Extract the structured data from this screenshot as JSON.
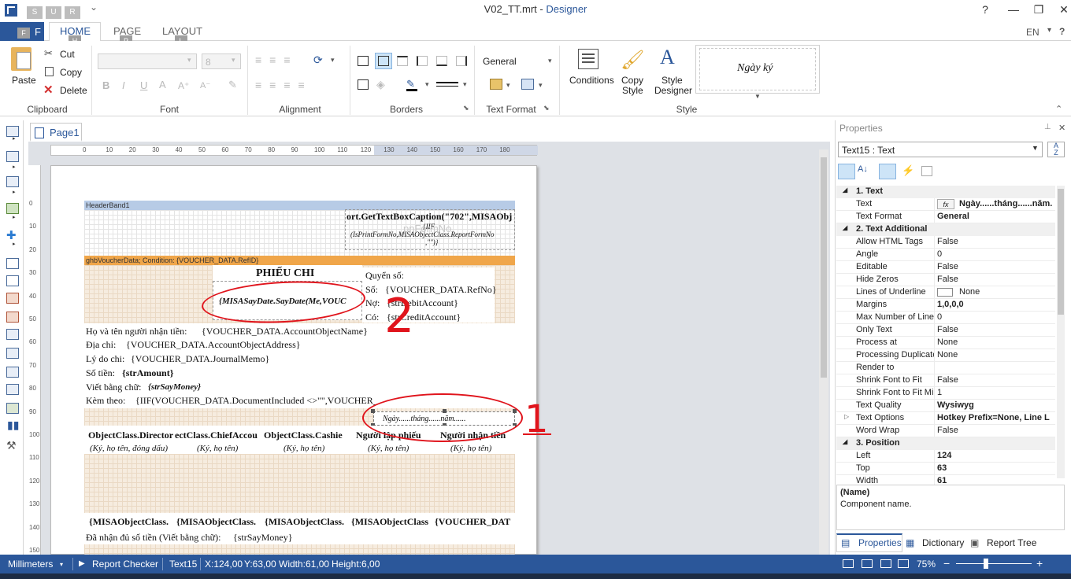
{
  "window": {
    "file_name": "V02_TT.mrt",
    "separator": " - ",
    "app_name": "Designer",
    "language": "EN",
    "help": "?",
    "qat_keys": [
      "S",
      "U",
      "R"
    ]
  },
  "tabs": {
    "file_key": "F",
    "home": "HOME",
    "home_key": "H",
    "page": "PAGE",
    "page_key": "P",
    "layout": "LAYOUT",
    "layout_key": "L"
  },
  "ribbon": {
    "clipboard": {
      "paste": "Paste",
      "cut": "Cut",
      "copy": "Copy",
      "delete": "Delete",
      "label": "Clipboard"
    },
    "font": {
      "size": "8",
      "label": "Font"
    },
    "alignment": {
      "label": "Alignment"
    },
    "borders": {
      "label": "Borders"
    },
    "text_format": {
      "value": "General",
      "label": "Text Format"
    },
    "style": {
      "conditions": "Conditions",
      "copy_style_1": "Copy",
      "copy_style_2": "Style",
      "style_designer_1": "Style",
      "style_designer_2": "Designer",
      "preview_text": "Ngày ký",
      "label": "Style"
    }
  },
  "document": {
    "page_tab": "Page1"
  },
  "ruler": {
    "h": [
      "0",
      "10",
      "20",
      "30",
      "40",
      "50",
      "60",
      "70",
      "80",
      "90",
      "100",
      "110",
      "120",
      "130",
      "140",
      "150",
      "160",
      "170",
      "180"
    ],
    "v": [
      "0",
      "10",
      "20",
      "30",
      "40",
      "50",
      "60",
      "70",
      "80",
      "90",
      "100",
      "110",
      "120",
      "130",
      "140",
      "150"
    ]
  },
  "report": {
    "header_band": "HeaderBand1",
    "caption_expr": "ort.GetTextBoxCaption(\"702\",MISAObj",
    "iif_line1": "{IIF",
    "iif_line2": "(IsPrintFormNo,MISAObjectClass.ReportFormNo",
    "iif_line3": ",\"\")}",
    "watermark": "pnFormNo",
    "data_band": "ghbVoucherData; Condition: {VOUCHER_DATA.RefID}",
    "title": "PHIẾU CHI",
    "date_expr": "{MISASayDate.SayDate(Me,VOUC",
    "book_label": "Quyển số:",
    "so_label": "Số:",
    "refno": "{VOUCHER_DATA.RefNo}",
    "no_label": "Nợ:",
    "debit": "{strDebitAccount}",
    "co_label": "Có:",
    "credit": "{strCreditAccount}",
    "recipient_label": "Họ và tên người nhận tiền:",
    "recipient_value": "{VOUCHER_DATA.AccountObjectName}",
    "address_label": "Địa chỉ:",
    "address_value": "{VOUCHER_DATA.AccountObjectAddress}",
    "reason_label": "Lý do chi:",
    "reason_value": "{VOUCHER_DATA.JournalMemo}",
    "amount_label": "Số tiền:",
    "amount_value": "{strAmount}",
    "words_label": "Viết bằng chữ:",
    "words_value": "{strSayMoney}",
    "attach_label": "Kèm theo:",
    "attach_value": "{IIF(VOUCHER_DATA.DocumentIncluded <>\"\",VOUCHER_",
    "selected_text": "Ngày......tháng......năm......",
    "sign_headers": [
      "ObjectClass.Director",
      "ectClass.ChiefAccou",
      "ObjectClass.Cashie",
      "Người lập phiếu",
      "Người nhận tiền"
    ],
    "sign_subs": [
      "(Ký, họ tên, đóng dấu)",
      "(Ký, họ tên)",
      "(Ký, họ tên)",
      "(Ký, họ tên)",
      "(Ký, họ tên)"
    ],
    "sign_names": [
      "{MISAObjectClass.",
      "{MISAObjectClass.",
      "{MISAObjectClass.",
      "{MISAObjectClass",
      "{VOUCHER_DAT"
    ],
    "received_label": "Đã nhận đủ số tiền (Viết bằng chữ):",
    "received_value": "{strSayMoney}",
    "annotations": {
      "one": "1",
      "two": "2"
    }
  },
  "properties": {
    "title": "Properties",
    "pin": "⊥",
    "close": "✕",
    "component": "Text15 : Text",
    "rows": [
      {
        "cat": true,
        "name": "1. Text",
        "value": ""
      },
      {
        "cat": false,
        "name": "Text",
        "value": "Ngày......tháng......năm.",
        "bold": true,
        "fx": true
      },
      {
        "cat": false,
        "name": "Text Format",
        "value": "General",
        "bold": true
      },
      {
        "cat": true,
        "name": "2. Text  Additional",
        "value": ""
      },
      {
        "cat": false,
        "name": "Allow HTML Tags",
        "value": "False"
      },
      {
        "cat": false,
        "name": "Angle",
        "value": "0"
      },
      {
        "cat": false,
        "name": "Editable",
        "value": "False"
      },
      {
        "cat": false,
        "name": "Hide Zeros",
        "value": "False"
      },
      {
        "cat": false,
        "name": "Lines of Underline",
        "value": "None",
        "swatch": true
      },
      {
        "cat": false,
        "name": "Margins",
        "value": "1,0,0,0",
        "bold": true
      },
      {
        "cat": false,
        "name": "Max Number of Lines",
        "value": "0"
      },
      {
        "cat": false,
        "name": "Only Text",
        "value": "False"
      },
      {
        "cat": false,
        "name": "Process at",
        "value": "None"
      },
      {
        "cat": false,
        "name": "Processing Duplicates",
        "value": "None"
      },
      {
        "cat": false,
        "name": "Render to",
        "value": ""
      },
      {
        "cat": false,
        "name": "Shrink Font to Fit",
        "value": "False"
      },
      {
        "cat": false,
        "name": "Shrink Font to Fit Minimum",
        "value": "1"
      },
      {
        "cat": false,
        "name": "Text Quality",
        "value": "Wysiwyg",
        "bold": true
      },
      {
        "cat": false,
        "name": "Text Options",
        "value": "Hotkey Prefix=None, Line L",
        "bold": true,
        "expand": true
      },
      {
        "cat": false,
        "name": "Word Wrap",
        "value": "False"
      },
      {
        "cat": true,
        "name": "3. Position",
        "value": ""
      },
      {
        "cat": false,
        "name": "Left",
        "value": "124",
        "bold": true
      },
      {
        "cat": false,
        "name": "Top",
        "value": "63",
        "bold": true
      },
      {
        "cat": false,
        "name": "Width",
        "value": "61",
        "bold": true
      }
    ],
    "desc_title": "(Name)",
    "desc_text": "Component name.",
    "bottom_tabs": [
      "Properties",
      "Dictionary",
      "Report Tree"
    ]
  },
  "status": {
    "units": "Millimeters",
    "checker": "Report Checker",
    "component": "Text15",
    "x": "X:124,00",
    "y": "Y:63,00",
    "width": "Width:61,00",
    "height": "Height:6,00",
    "zoom": "75%"
  }
}
